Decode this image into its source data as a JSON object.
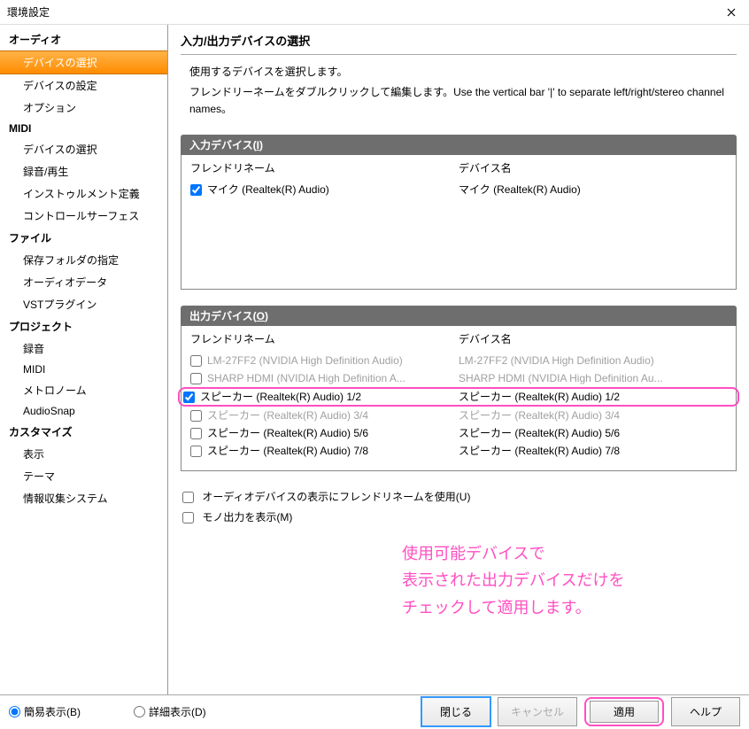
{
  "window": {
    "title": "環境設定"
  },
  "sidebar": {
    "categories": [
      {
        "label": "オーディオ",
        "items": [
          {
            "label": "デバイスの選択",
            "selected": true
          },
          {
            "label": "デバイスの設定"
          },
          {
            "label": "オプション"
          }
        ]
      },
      {
        "label": "MIDI",
        "items": [
          {
            "label": "デバイスの選択"
          },
          {
            "label": "録音/再生"
          },
          {
            "label": "インストゥルメント定義"
          },
          {
            "label": "コントロールサーフェス"
          }
        ]
      },
      {
        "label": "ファイル",
        "items": [
          {
            "label": "保存フォルダの指定"
          },
          {
            "label": "オーディオデータ"
          },
          {
            "label": "VSTプラグイン"
          }
        ]
      },
      {
        "label": "プロジェクト",
        "items": [
          {
            "label": "録音"
          },
          {
            "label": "MIDI"
          },
          {
            "label": "メトロノーム"
          },
          {
            "label": "AudioSnap"
          }
        ]
      },
      {
        "label": "カスタマイズ",
        "items": [
          {
            "label": "表示"
          },
          {
            "label": "テーマ"
          },
          {
            "label": "情報収集システム"
          }
        ]
      }
    ]
  },
  "page": {
    "title": "入力/出力デバイスの選択",
    "desc1": "使用するデバイスを選択します。",
    "desc2": "フレンドリーネームをダブルクリックして編集します。Use the vertical bar '|' to separate left/right/stereo channel names。"
  },
  "inputSection": {
    "title_prefix": "入力デバイス(",
    "title_key": "I",
    "title_suffix": ")",
    "col_friendly": "フレンドリネーム",
    "col_device": "デバイス名",
    "rows": [
      {
        "checked": true,
        "friendly": "マイク (Realtek(R) Audio)",
        "device": "マイク (Realtek(R) Audio)",
        "disabled": false
      }
    ]
  },
  "outputSection": {
    "title_prefix": "出力デバイス(",
    "title_key": "O",
    "title_suffix": ")",
    "col_friendly": "フレンドリネーム",
    "col_device": "デバイス名",
    "rows": [
      {
        "checked": false,
        "friendly": "LM-27FF2 (NVIDIA High Definition Audio)",
        "device": "LM-27FF2 (NVIDIA High Definition Audio)",
        "disabled": true
      },
      {
        "checked": false,
        "friendly": "SHARP HDMI (NVIDIA High Definition A...",
        "device": "SHARP HDMI (NVIDIA High Definition Au...",
        "disabled": true
      },
      {
        "checked": false,
        "friendly": "",
        "device": "",
        "disabled": true,
        "cut": true
      },
      {
        "checked": true,
        "friendly": "スピーカー (Realtek(R) Audio) 1/2",
        "device": "スピーカー (Realtek(R) Audio) 1/2",
        "disabled": false,
        "highlight": true
      },
      {
        "checked": false,
        "friendly": "スピーカー (Realtek(R) Audio) 3/4",
        "device": "スピーカー (Realtek(R) Audio) 3/4",
        "disabled": true
      },
      {
        "checked": false,
        "friendly": "スピーカー (Realtek(R) Audio) 5/6",
        "device": "スピーカー (Realtek(R) Audio) 5/6",
        "disabled": false
      },
      {
        "checked": false,
        "friendly": "スピーカー (Realtek(R) Audio) 7/8",
        "device": "スピーカー (Realtek(R) Audio) 7/8",
        "disabled": false
      }
    ]
  },
  "options": {
    "friendly_names": "オーディオデバイスの表示にフレンドリネームを使用(U)",
    "mono_out": "モノ出力を表示(M)"
  },
  "annotation": {
    "line1": "使用可能デバイスで",
    "line2": "表示された出力デバイスだけを",
    "line3": "チェックして適用します。"
  },
  "footer": {
    "radio_basic": "簡易表示(B)",
    "radio_detail": "詳細表示(D)",
    "btn_close": "閉じる",
    "btn_cancel": "キャンセル",
    "btn_apply": "適用",
    "btn_help": "ヘルプ"
  }
}
